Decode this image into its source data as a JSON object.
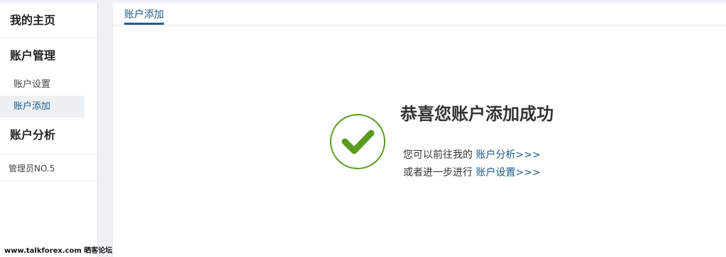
{
  "sidebar": {
    "home": "我的主页",
    "account_management": "账户管理",
    "items": [
      {
        "label": "账户设置"
      },
      {
        "label": "账户添加"
      }
    ],
    "account_analysis": "账户分析",
    "admin": "管理员NO.5"
  },
  "main": {
    "tab_label": "账户添加",
    "success_title": "恭喜您账户添加成功",
    "line1_prefix": "您可以前往我的 ",
    "line1_link": "账户分析>>>",
    "line2_prefix": "或者进一步进行 ",
    "line2_link": "账户设置>>>"
  },
  "watermark": "www.talkforex.com 晒客论坛",
  "colors": {
    "accent": "#1a5a8a",
    "success_green": "#5a9b1f",
    "background": "#eef1f5"
  },
  "icons": {
    "success": "check-circle-icon"
  }
}
